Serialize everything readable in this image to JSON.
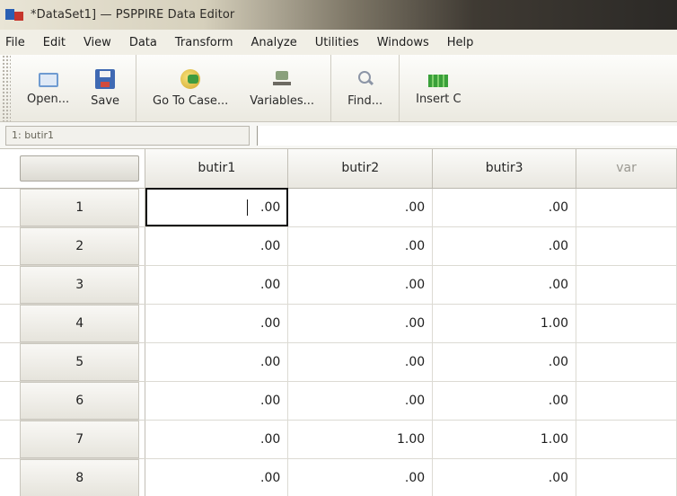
{
  "window": {
    "title": "*DataSet1] — PSPPIRE Data Editor"
  },
  "menu": [
    "File",
    "Edit",
    "View",
    "Data",
    "Transform",
    "Analyze",
    "Utilities",
    "Windows",
    "Help"
  ],
  "toolbar": {
    "open": "Open...",
    "save": "Save",
    "goto_case": "Go To Case...",
    "variables": "Variables...",
    "find": "Find...",
    "insert_cases": "Insert C"
  },
  "cell_ref": {
    "name": "1: butir1",
    "value": ""
  },
  "grid": {
    "columns": [
      "butir1",
      "butir2",
      "butir3",
      "var"
    ],
    "rows": [
      {
        "n": "1",
        "values": [
          ".00",
          ".00",
          ".00",
          ""
        ]
      },
      {
        "n": "2",
        "values": [
          ".00",
          ".00",
          ".00",
          ""
        ]
      },
      {
        "n": "3",
        "values": [
          ".00",
          ".00",
          ".00",
          ""
        ]
      },
      {
        "n": "4",
        "values": [
          ".00",
          ".00",
          "1.00",
          ""
        ]
      },
      {
        "n": "5",
        "values": [
          ".00",
          ".00",
          ".00",
          ""
        ]
      },
      {
        "n": "6",
        "values": [
          ".00",
          ".00",
          ".00",
          ""
        ]
      },
      {
        "n": "7",
        "values": [
          ".00",
          "1.00",
          "1.00",
          ""
        ]
      },
      {
        "n": "8",
        "values": [
          ".00",
          ".00",
          ".00",
          ""
        ]
      }
    ]
  }
}
